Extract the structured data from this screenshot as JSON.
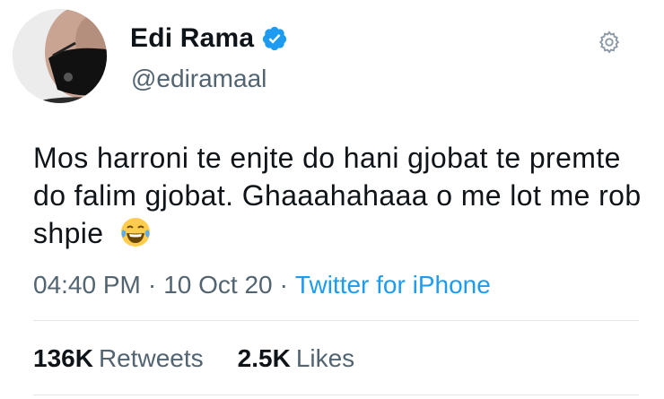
{
  "author": {
    "name": "Edi Rama",
    "handle": "@ediramaal",
    "verified": true,
    "verified_color": "#1d9bf0"
  },
  "tweet": {
    "text": "Mos harroni te enjte do hani gjobat te premte do falim gjobat. Ghaaahahaaa o me lot me rob shpie",
    "emoji": "tears-of-joy-emoji"
  },
  "meta": {
    "time": "04:40 PM",
    "separator": "·",
    "date": "10 Oct 20",
    "source": "Twitter for iPhone"
  },
  "stats": {
    "retweets_count": "136K",
    "retweets_label": "Retweets",
    "likes_count": "2.5K",
    "likes_label": "Likes"
  },
  "icons": [
    "gear-icon",
    "verified-badge-icon"
  ],
  "colors": {
    "text": "#0f1419",
    "secondary": "#536471",
    "link": "#1d9bf0"
  }
}
